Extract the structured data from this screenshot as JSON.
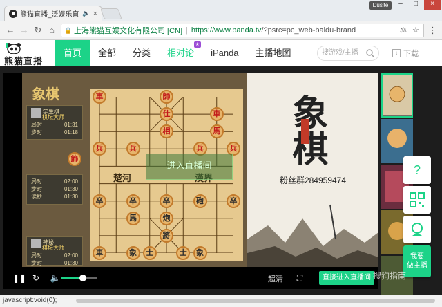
{
  "browser": {
    "tab_title": "熊猫直播_泛娱乐直播",
    "speaker_icon": "speaker-icon",
    "profile_label": "Dusite",
    "org_name": "上海熊猫互娱文化有限公司 [CN]",
    "url_main": "https://www.panda.tv",
    "url_rest": "/?psrc=pc_web-baidu-brand"
  },
  "site": {
    "brand": "熊猫直播",
    "nav": [
      {
        "label": "首页"
      },
      {
        "label": "全部"
      },
      {
        "label": "分类"
      },
      {
        "label": "相对论"
      },
      {
        "label": "iPanda"
      },
      {
        "label": "主播地图"
      }
    ],
    "search_placeholder": "搜游戏/主播",
    "download_label": "下载"
  },
  "player": {
    "game_title": "象棋",
    "top_panel": {
      "name": "学生棋",
      "level": "棋坛大师",
      "rows": [
        {
          "k": "局时",
          "v": "01:31"
        },
        {
          "k": "步时",
          "v": "01:18"
        }
      ]
    },
    "mid_panel": {
      "rows": [
        {
          "k": "局时",
          "v": "02:00"
        },
        {
          "k": "步时",
          "v": "01:30"
        },
        {
          "k": "读秒",
          "v": "01:30"
        }
      ]
    },
    "bottom_panel": {
      "name": "神秘",
      "level": "棋坛大师",
      "rows": [
        {
          "k": "局时",
          "v": "02:00"
        },
        {
          "k": "步时",
          "v": "01:30"
        }
      ]
    },
    "river_left": "楚河",
    "river_right": "漢界",
    "overlay_text": "进入直播间",
    "poster_title": "象棋",
    "poster_fans": "粉丝群284959474",
    "quality_label": "超清",
    "enter_button": "直接进入直播间",
    "volume_level": 0.62
  },
  "floating": {
    "anchor_line1": "我要",
    "anchor_line2": "做主播"
  },
  "watermark": "搜狗指南",
  "status_text": "javascript:void(0);",
  "pieces": [
    {
      "t": "車",
      "c": "red",
      "col": 0,
      "row": 0
    },
    {
      "t": "師",
      "c": "red",
      "col": 4,
      "row": 0
    },
    {
      "t": "仕",
      "c": "red",
      "col": 4,
      "row": 1
    },
    {
      "t": "相",
      "c": "red",
      "col": 4,
      "row": 2
    },
    {
      "t": "車",
      "c": "red",
      "col": 7,
      "row": 1
    },
    {
      "t": "馬",
      "c": "red",
      "col": 7,
      "row": 2
    },
    {
      "t": "兵",
      "c": "red",
      "col": 0,
      "row": 3
    },
    {
      "t": "兵",
      "c": "red",
      "col": 2,
      "row": 3
    },
    {
      "t": "兵",
      "c": "red",
      "col": 6,
      "row": 3
    },
    {
      "t": "兵",
      "c": "red",
      "col": 8,
      "row": 3
    },
    {
      "t": "卒",
      "c": "black",
      "col": 0,
      "row": 6
    },
    {
      "t": "卒",
      "c": "black",
      "col": 2,
      "row": 6
    },
    {
      "t": "卒",
      "c": "black",
      "col": 4,
      "row": 6
    },
    {
      "t": "砲",
      "c": "black",
      "col": 6,
      "row": 6
    },
    {
      "t": "卒",
      "c": "black",
      "col": 8,
      "row": 6
    },
    {
      "t": "馬",
      "c": "black",
      "col": 2,
      "row": 7
    },
    {
      "t": "炮",
      "c": "black",
      "col": 4,
      "row": 7
    },
    {
      "t": "將",
      "c": "black",
      "col": 4,
      "row": 8
    },
    {
      "t": "車",
      "c": "black",
      "col": 0,
      "row": 9
    },
    {
      "t": "象",
      "c": "black",
      "col": 2,
      "row": 9
    },
    {
      "t": "士",
      "c": "black",
      "col": 3,
      "row": 9
    },
    {
      "t": "士",
      "c": "black",
      "col": 5,
      "row": 9
    },
    {
      "t": "象",
      "c": "black",
      "col": 6,
      "row": 9
    }
  ],
  "side_piece": {
    "t": "飾",
    "c": "red"
  }
}
